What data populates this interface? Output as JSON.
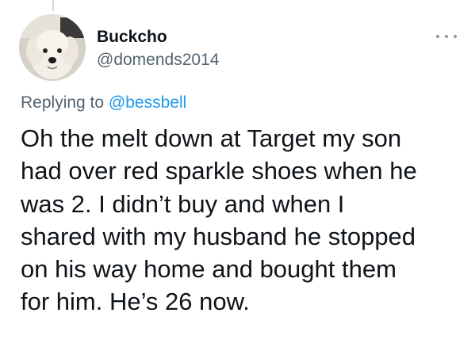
{
  "author": {
    "display_name": "Buckcho",
    "handle": "@domends2014",
    "avatar_icon": "dog-avatar-icon"
  },
  "more_icon": "more-dots-icon",
  "reply": {
    "prefix": "Replying to ",
    "mention": "@bessbell"
  },
  "tweet": {
    "lines": [
      "Oh the melt down at Target my son",
      "had over red sparkle shoes when he",
      "was 2. I didn’t buy and when I",
      "shared with my husband he stopped",
      "on his way home and bought them",
      "for him. He’s 26 now."
    ]
  },
  "colors": {
    "text": "#0f1419",
    "secondary": "#536471",
    "link": "#1d9bf0"
  }
}
